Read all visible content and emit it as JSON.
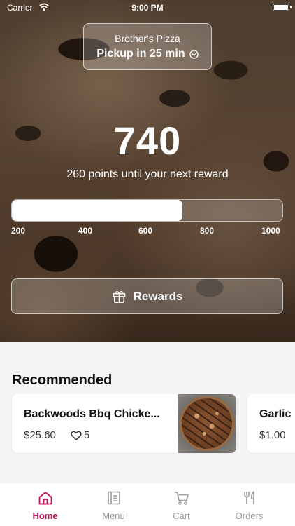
{
  "status_bar": {
    "carrier": "Carrier",
    "time": "9:00 PM"
  },
  "store": {
    "name": "Brother's Pizza",
    "pickup": "Pickup in 25 min"
  },
  "points": {
    "value": "740",
    "caption": "260 points until your next reward",
    "progress_fraction": 0.63,
    "ticks": [
      "200",
      "400",
      "600",
      "800",
      "1000"
    ]
  },
  "rewards_button": {
    "label": "Rewards"
  },
  "recommended": {
    "title": "Recommended",
    "items": [
      {
        "name": "Backwoods Bbq Chicke...",
        "price": "$25.60",
        "likes": "5"
      },
      {
        "name": "Garlic",
        "price": "$1.00"
      }
    ]
  },
  "tabs": [
    {
      "label": "Home",
      "icon": "home-icon",
      "active": true
    },
    {
      "label": "Menu",
      "icon": "menu-icon",
      "active": false
    },
    {
      "label": "Cart",
      "icon": "cart-icon",
      "active": false
    },
    {
      "label": "Orders",
      "icon": "orders-icon",
      "active": false
    }
  ],
  "colors": {
    "accent": "#c2185b",
    "inactive": "#9a9aa0"
  }
}
